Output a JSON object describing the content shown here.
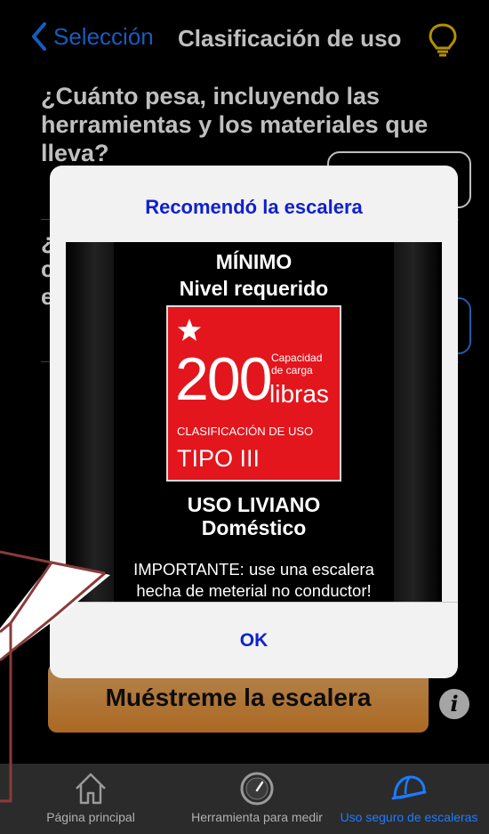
{
  "nav": {
    "back_label": "Selección",
    "title": "Clasificación de uso"
  },
  "question": {
    "text": "¿Cuánto pesa, incluyendo las herramientas y los materiales que lleva?",
    "q2_fragment": "¿ c e"
  },
  "show_ladder_button": "Muéstreme la escalera",
  "info_button": "i",
  "tabs": [
    {
      "label": "Página principal",
      "icon": "home-icon"
    },
    {
      "label": "Herramienta para medir",
      "icon": "gauge-icon"
    },
    {
      "label": "Uso seguro de escaleras",
      "icon": "hardhat-icon",
      "active": true
    }
  ],
  "alert": {
    "title": "Recomendó la escalera",
    "minimum": "MÍNIMO",
    "required_level": "Nivel requerido",
    "label": {
      "capacity_value": "200",
      "capacity_caption": "Capacidad de carga",
      "unit": "libras",
      "classification_caption": "CLASIFICACIÓN DE USO",
      "type": "TIPO III"
    },
    "use_title": "USO LIVIANO",
    "use_sub": "Doméstico",
    "important": "IMPORTANTE: use una escalera hecha de meterial no conductor!",
    "ok": "OK"
  },
  "colors": {
    "accent_blue": "#1e7bff",
    "alert_blue": "#1020d0",
    "label_red": "#e3151d",
    "button_orange": "#e58c2f",
    "callout_outline": "#8b3a3a"
  }
}
